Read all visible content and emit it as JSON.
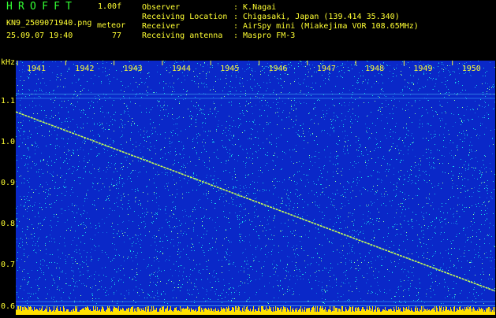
{
  "app": {
    "title": "HROFFT",
    "version": "1.00f"
  },
  "file": {
    "name": "KN9_2509071940.png",
    "datetime": "25.09.07 19:40"
  },
  "meteor": {
    "label": "meteor",
    "count": "77"
  },
  "info": [
    {
      "label": "Observer",
      "value": ": K.Nagai"
    },
    {
      "label": "Receiving Location",
      "value": ": Chigasaki, Japan (139.414 35.340)"
    },
    {
      "label": "Receiver",
      "value": ": AirSpy mini (Miakejima VOR 108.65MHz)"
    },
    {
      "label": "Receiving antenna",
      "value": ": Maspro FM-3"
    }
  ],
  "spectrogram": {
    "yunit": "kHz",
    "ylim": [
      0.58,
      1.2
    ],
    "yticks": [
      "1.1",
      "1.0",
      "0.9",
      "0.8",
      "0.7",
      "0.6"
    ],
    "time_ticks": [
      "1941",
      "1942",
      "1943",
      "1944",
      "1945",
      "1946",
      "1947",
      "1948",
      "1949",
      "1950"
    ],
    "colors": {
      "bg": "#0a28c8",
      "trace": "#c8ff50",
      "noise": "#19d2e6",
      "base": "#ffe000"
    }
  }
}
